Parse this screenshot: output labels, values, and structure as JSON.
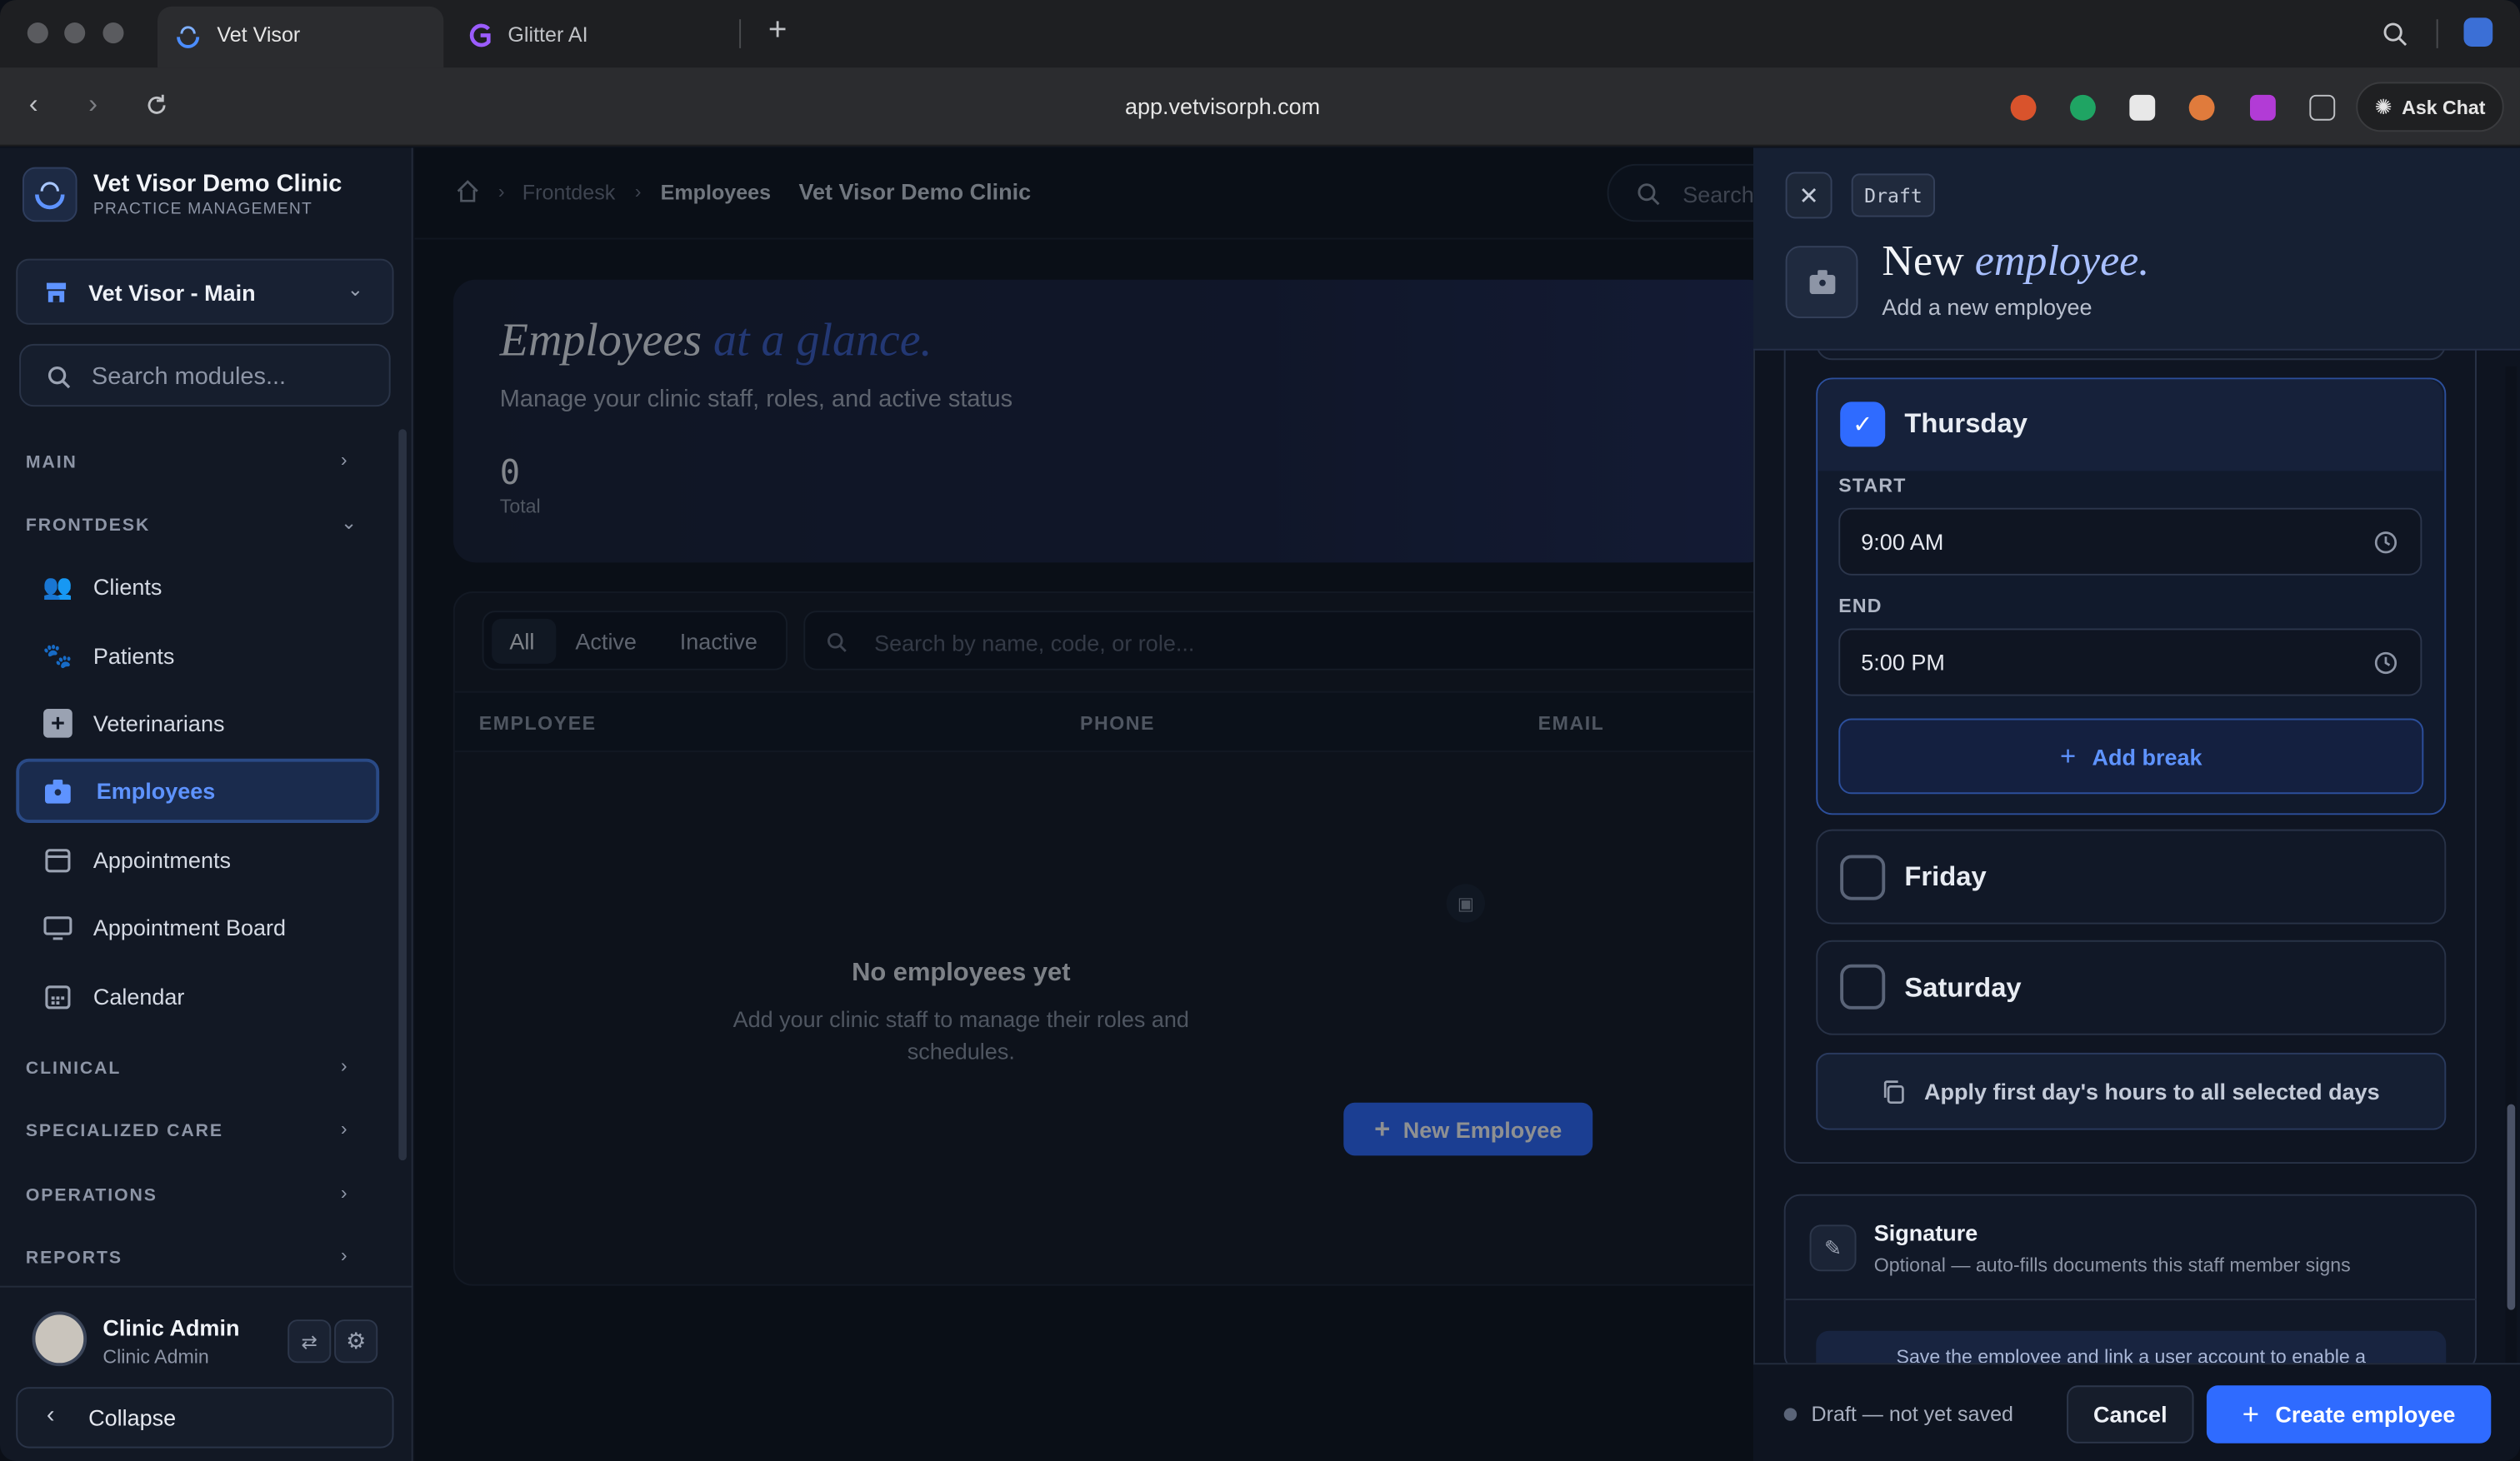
{
  "browser": {
    "tabs": [
      {
        "label": "Vet Visor"
      },
      {
        "label": "Glitter AI"
      }
    ],
    "url": "app.vetvisorph.com",
    "ask_chat": "Ask Chat"
  },
  "sidebar": {
    "clinic_name": "Vet Visor Demo Clinic",
    "clinic_subtitle": "PRACTICE MANAGEMENT",
    "branch": "Vet Visor - Main",
    "search_placeholder": "Search modules...",
    "sections": {
      "main": "MAIN",
      "frontdesk": "FRONTDESK",
      "clinical": "CLINICAL",
      "specialized": "SPECIALIZED CARE",
      "operations": "OPERATIONS",
      "reports": "REPORTS"
    },
    "items": [
      {
        "label": "Clients",
        "icon": "people-icon"
      },
      {
        "label": "Patients",
        "icon": "paw-icon"
      },
      {
        "label": "Veterinarians",
        "icon": "medical-plus-icon"
      },
      {
        "label": "Employees",
        "icon": "badge-icon"
      },
      {
        "label": "Appointments",
        "icon": "calendar-icon"
      },
      {
        "label": "Appointment Board",
        "icon": "monitor-icon"
      },
      {
        "label": "Calendar",
        "icon": "calendar-grid-icon"
      }
    ],
    "user": {
      "name": "Clinic Admin",
      "role": "Clinic Admin"
    },
    "collapse": "Collapse"
  },
  "main": {
    "breadcrumb": [
      "Frontdesk",
      "Employees"
    ],
    "clinic": "Vet Visor Demo Clinic",
    "search_placeholder": "Search",
    "hero": {
      "title_a": "Employees",
      "title_b": "at a glance.",
      "subtitle": "Manage your clinic staff, roles, and active status",
      "total_value": "0",
      "total_label": "Total"
    },
    "filters": [
      "All",
      "Active",
      "Inactive"
    ],
    "table_search_placeholder": "Search by name, code, or role...",
    "columns": [
      "EMPLOYEE",
      "PHONE",
      "EMAIL"
    ],
    "empty": {
      "title": "No employees yet",
      "line1": "Add your clinic staff to manage their roles and",
      "line2": "schedules.",
      "button": "New Employee"
    }
  },
  "drawer": {
    "badge": "Draft",
    "title_a": "New",
    "title_b": "employee.",
    "subtitle": "Add a new employee",
    "thursday": {
      "day": "Thursday",
      "start_label": "START",
      "start": "9:00 AM",
      "end_label": "END",
      "end": "5:00 PM",
      "add_break": "Add break"
    },
    "friday": "Friday",
    "saturday": "Saturday",
    "apply_all": "Apply first day's hours to all selected days",
    "signature": {
      "title": "Signature",
      "desc": "Optional — auto-fills documents this staff member signs",
      "notice": "Save the employee and link a user account to enable a"
    },
    "status": "Draft — not yet saved",
    "cancel": "Cancel",
    "create": "Create employee"
  },
  "colors": {
    "accent": "#2f6bff",
    "active_nav": "#5e93ff",
    "check": "#2f6bff"
  }
}
